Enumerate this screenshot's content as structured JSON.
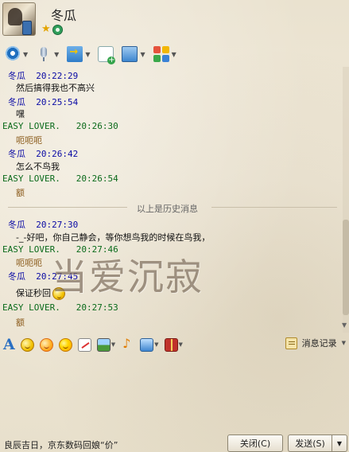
{
  "header": {
    "nickname": "冬瓜"
  },
  "toolbar": {
    "items": [
      {
        "icon": "video-camera-icon"
      },
      {
        "icon": "microphone-icon"
      },
      {
        "icon": "send-file-icon"
      },
      {
        "icon": "new-message-icon"
      },
      {
        "icon": "remote-screen-icon"
      },
      {
        "icon": "apps-icon"
      }
    ]
  },
  "chat": {
    "messages": [
      {
        "sender": "冬瓜",
        "time": "20:22:29",
        "text": "然后搞得我也不高兴"
      },
      {
        "sender": "冬瓜",
        "time": "20:25:54",
        "text": "嘿"
      },
      {
        "sender": "EASY LOVER.",
        "time": "20:26:30",
        "text": "呃呃呃"
      },
      {
        "sender": "冬瓜",
        "time": "20:26:42",
        "text": "怎么不鸟我"
      },
      {
        "sender": "EASY LOVER.",
        "time": "20:26:54",
        "text": "额"
      },
      {
        "sender": "冬瓜",
        "time": "20:27:30",
        "text": "-_-好吧，你自己静会，等你想鸟我的时候在鸟我，"
      },
      {
        "sender": "EASY LOVER.",
        "time": "20:27:46",
        "text": "呃呃呃"
      },
      {
        "sender": "冬瓜",
        "time": "20:27:45",
        "text": "保证秒回"
      },
      {
        "sender": "EASY LOVER.",
        "time": "20:27:53",
        "text": "额"
      }
    ],
    "history_divider": "以上是历史消息",
    "watermark": "当爱沉寂"
  },
  "format_toolbar": {
    "history_label": "消息记录"
  },
  "bottom": {
    "ad_text": "良辰吉日，京东数码回娘“价”",
    "close_label": "关闭(C)",
    "send_label": "发送(S)"
  },
  "colors": {
    "friend_name": "#0a0aa5",
    "my_name": "#0a6a1a",
    "my_message_text": "#8a5a1a"
  }
}
